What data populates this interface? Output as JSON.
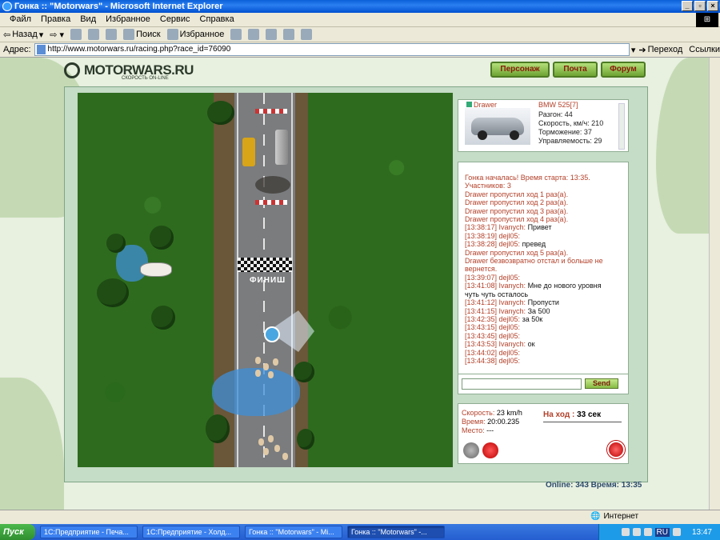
{
  "window": {
    "title": "Гонка :: \"Motorwars\" - Microsoft Internet Explorer"
  },
  "menu": [
    "Файл",
    "Правка",
    "Вид",
    "Избранное",
    "Сервис",
    "Справка"
  ],
  "toolbar": {
    "back": "Назад",
    "search": "Поиск",
    "favorites": "Избранное"
  },
  "address": {
    "label": "Адрес:",
    "url": "http://www.motorwars.ru/racing.php?race_id=76090",
    "go": "Переход",
    "links": "Ссылки"
  },
  "site": {
    "logo": "MOTORWARS.RU",
    "tagline": "СКОРОСТЬ ON-LINE",
    "nav": [
      "Персонаж",
      "Почта",
      "Форум"
    ]
  },
  "track": {
    "finish_label": "ФИНИШ"
  },
  "car": {
    "driver": "Drawer",
    "model": "BMW 525[7]",
    "stats": [
      "Разгон: 44",
      "Скорость, км/ч: 210",
      "Торможение: 37",
      "Управляемость: 29"
    ]
  },
  "chat": {
    "messages": [
      {
        "type": "sys",
        "text": "Гонка началась! Время старта: 13:35."
      },
      {
        "type": "sys",
        "text": "Участников: 3"
      },
      {
        "type": "sys",
        "text": "Drawer пропустил ход 1 раз(а)."
      },
      {
        "type": "sys",
        "text": "Drawer пропустил ход 2 раз(а)."
      },
      {
        "type": "sys",
        "text": "Drawer пропустил ход 3 раз(а)."
      },
      {
        "type": "sys",
        "text": "Drawer пропустил ход 4 раз(а)."
      },
      {
        "type": "usr",
        "time": "[13:38:17] Ivanych:",
        "text": "Привет"
      },
      {
        "type": "usr",
        "time": "[13:38:19] dejl05:",
        "text": ""
      },
      {
        "type": "usr",
        "time": "[13:38:28] dejl05:",
        "text": "превед"
      },
      {
        "type": "sys",
        "text": "Drawer пропустил ход 5 раз(а)."
      },
      {
        "type": "sys",
        "text": "Drawer безвозвратно отстал и больше не вернется."
      },
      {
        "type": "usr",
        "time": "[13:39:07] dejl05:",
        "text": ""
      },
      {
        "type": "usr",
        "time": "[13:41:08] Ivanych:",
        "text": "Мне до нового уровня чуть чуть осталось"
      },
      {
        "type": "usr",
        "time": "[13:41:12] Ivanych:",
        "text": "Пропусти"
      },
      {
        "type": "usr",
        "time": "[13:41:15] Ivanych:",
        "text": "За 500"
      },
      {
        "type": "usr",
        "time": "[13:42:35] dejl05:",
        "text": "за 50к"
      },
      {
        "type": "usr",
        "time": "[13:43:15] dejl05:",
        "text": ""
      },
      {
        "type": "usr",
        "time": "[13:43:45] dejl05:",
        "text": ""
      },
      {
        "type": "usr",
        "time": "[13:43:53] Ivanych:",
        "text": "ок"
      },
      {
        "type": "usr",
        "time": "[13:44:02] dejl05:",
        "text": ""
      },
      {
        "type": "usr",
        "time": "[13:44:38] dejl05:",
        "text": ""
      }
    ],
    "send": "Send"
  },
  "race_info": {
    "speed_label": "Скорость:",
    "speed": "23 km/h",
    "time_label": "Время:",
    "time": "20:00.235",
    "place_label": "Место:",
    "place": "---",
    "turn_label": "На ход :",
    "turn": "33 сек"
  },
  "footer": {
    "online": "Online: 343  Время: 13:35"
  },
  "statusbar": {
    "zone": "Интернет"
  },
  "taskbar": {
    "start": "Пуск",
    "tasks": [
      "1С:Предприятие - Печа...",
      "1С:Предприятие - Холд...",
      "Гонка :: \"Motorwars\" - Mi...",
      "Гонка :: \"Motorwars\" -..."
    ],
    "lang": "RU",
    "clock": "13:47"
  },
  "colors": {
    "accent_red": "#b3412a",
    "nav_green": "#87bb44",
    "grass": "#2e6b1e"
  }
}
